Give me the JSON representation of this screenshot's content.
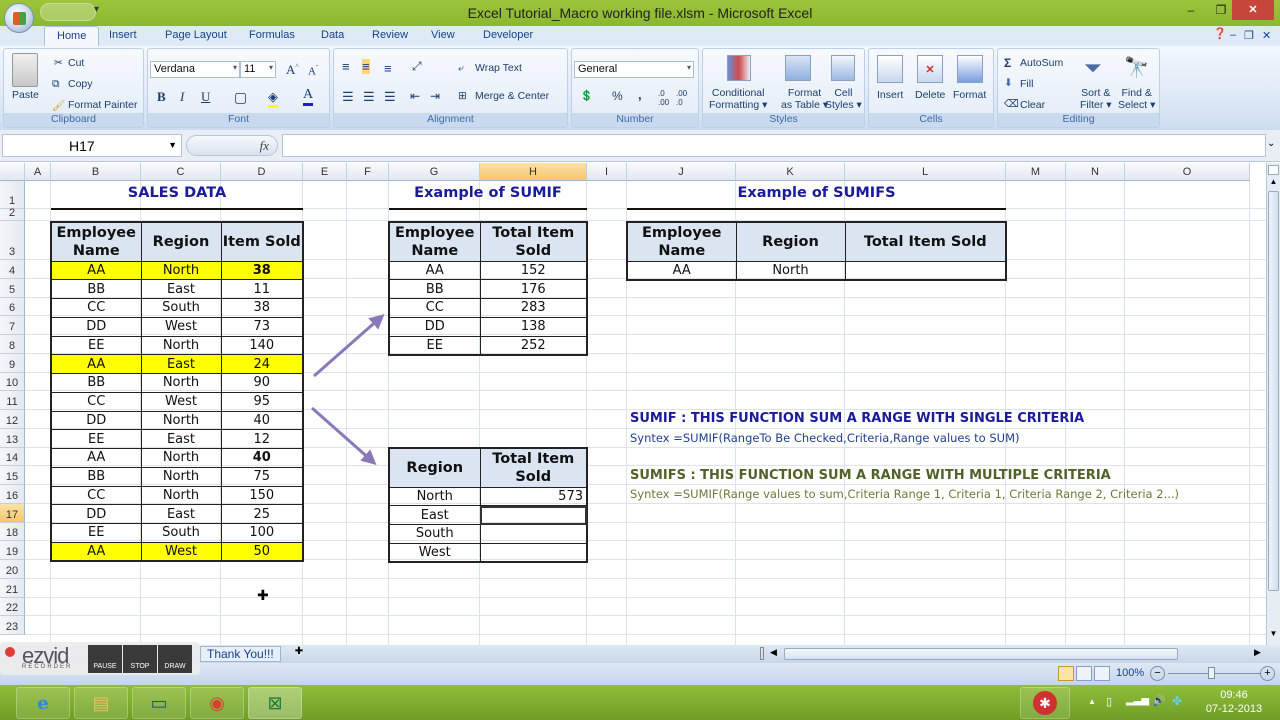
{
  "window": {
    "title": "Excel Tutorial_Macro working file.xlsm - Microsoft Excel",
    "controls": {
      "minimize": "–",
      "restore": "❐",
      "close": "✕"
    }
  },
  "ribbon_tabs": [
    "Home",
    "Insert",
    "Page Layout",
    "Formulas",
    "Data",
    "Review",
    "View",
    "Developer"
  ],
  "active_tab": "Home",
  "ribbon": {
    "clipboard": {
      "label": "Clipboard",
      "paste": "Paste",
      "cut": "Cut",
      "copy": "Copy",
      "format_painter": "Format Painter"
    },
    "font": {
      "label": "Font",
      "font_name": "Verdana",
      "font_size": "11",
      "bold": "B",
      "italic": "I",
      "underline": "U"
    },
    "alignment": {
      "label": "Alignment",
      "wrap_text": "Wrap Text",
      "merge_center": "Merge & Center"
    },
    "number": {
      "label": "Number",
      "format": "General",
      "percent": "%",
      "comma": ","
    },
    "styles": {
      "label": "Styles",
      "conditional": [
        "Conditional",
        "Formatting"
      ],
      "format_table": [
        "Format",
        "as Table"
      ],
      "cell_styles": [
        "Cell",
        "Styles"
      ]
    },
    "cells": {
      "label": "Cells",
      "insert": "Insert",
      "delete": "Delete",
      "format": "Format"
    },
    "editing": {
      "label": "Editing",
      "autosum": "AutoSum",
      "fill": "Fill",
      "clear": "Clear",
      "sort_filter": [
        "Sort &",
        "Filter"
      ],
      "find_select": [
        "Find &",
        "Select"
      ]
    }
  },
  "formula_bar": {
    "name_box": "H17",
    "fx": "fx",
    "formula": ""
  },
  "columns": [
    "A",
    "B",
    "C",
    "D",
    "E",
    "F",
    "G",
    "H",
    "I",
    "J",
    "K",
    "L",
    "M",
    "N",
    "O"
  ],
  "selected_column": "H",
  "rows": [
    "1",
    "2",
    "3",
    "4",
    "5",
    "6",
    "7",
    "8",
    "9",
    "10",
    "11",
    "12",
    "13",
    "14",
    "15",
    "16",
    "17",
    "18",
    "19",
    "20",
    "21",
    "22",
    "23"
  ],
  "selected_row": "17",
  "sales_data": {
    "title": "SALES DATA",
    "headers": [
      "Employee Name",
      "Region",
      "Item Sold"
    ],
    "rows": [
      {
        "name": "AA",
        "region": "North",
        "sold": "38",
        "highlight": true,
        "bold": true
      },
      {
        "name": "BB",
        "region": "East",
        "sold": "11"
      },
      {
        "name": "CC",
        "region": "South",
        "sold": "38"
      },
      {
        "name": "DD",
        "region": "West",
        "sold": "73"
      },
      {
        "name": "EE",
        "region": "North",
        "sold": "140"
      },
      {
        "name": "AA",
        "region": "East",
        "sold": "24",
        "highlight": true
      },
      {
        "name": "BB",
        "region": "North",
        "sold": "90"
      },
      {
        "name": "CC",
        "region": "West",
        "sold": "95"
      },
      {
        "name": "DD",
        "region": "North",
        "sold": "40"
      },
      {
        "name": "EE",
        "region": "East",
        "sold": "12"
      },
      {
        "name": "AA",
        "region": "North",
        "sold": "40",
        "bold": true
      },
      {
        "name": "BB",
        "region": "North",
        "sold": "75"
      },
      {
        "name": "CC",
        "region": "North",
        "sold": "150"
      },
      {
        "name": "DD",
        "region": "East",
        "sold": "25"
      },
      {
        "name": "EE",
        "region": "South",
        "sold": "100"
      },
      {
        "name": "AA",
        "region": "West",
        "sold": "50",
        "highlight": true
      }
    ]
  },
  "sumif_example": {
    "title": "Example of SUMIF",
    "headers": [
      "Employee Name",
      "Total Item Sold"
    ],
    "rows": [
      {
        "name": "AA",
        "total": "152"
      },
      {
        "name": "BB",
        "total": "176"
      },
      {
        "name": "CC",
        "total": "283"
      },
      {
        "name": "DD",
        "total": "138"
      },
      {
        "name": "EE",
        "total": "252"
      }
    ]
  },
  "region_table": {
    "headers": [
      "Region",
      "Total Item Sold"
    ],
    "rows": [
      {
        "region": "North",
        "total": "573"
      },
      {
        "region": "East",
        "total": ""
      },
      {
        "region": "South",
        "total": ""
      },
      {
        "region": "West",
        "total": ""
      }
    ]
  },
  "sumifs_example": {
    "title": "Example of SUMIFS",
    "headers": [
      "Employee Name",
      "Region",
      "Total Item Sold"
    ],
    "rows": [
      {
        "name": "AA",
        "region": "North",
        "total": ""
      }
    ]
  },
  "notes": {
    "sumif_heading": "SUMIF : THIS FUNCTION SUM A RANGE WITH SINGLE CRITERIA",
    "sumif_syntax": "Syntex =SUMIF(RangeTo Be Checked,Criteria,Range values to SUM)",
    "sumifs_heading": "SUMIFS : THIS FUNCTION SUM A RANGE WITH MULTIPLE CRITERIA",
    "sumifs_syntax": "Syntex =SUMIF(Range values to sum,Criteria Range 1, Criteria 1, Criteria Range 2, Criteria 2...)",
    "colors": {
      "sumif": "#1a1a9c",
      "sumifs": "#4f6228",
      "syntax_blue": "#1f3f8f",
      "syntax_green": "#6b7a3a"
    }
  },
  "sheet_tabs": {
    "visible": "Thank You!!!"
  },
  "status": {
    "zoom": "100%"
  },
  "ezvid": {
    "brand": "ezvid",
    "sub": "RECORDER",
    "pause": "PAUSE",
    "stop": "STOP",
    "draw": "DRAW"
  },
  "taskbar": {
    "apps": [
      "internet-explorer",
      "file-explorer",
      "lenovo",
      "chrome",
      "excel"
    ],
    "time": "09:46",
    "date": "07-12-2013"
  },
  "colors": {
    "highlight": "#ffff00",
    "header_fill": "#dbe5f1",
    "title_blue": "#1a1a9c",
    "arrow": "#8a78b8"
  }
}
